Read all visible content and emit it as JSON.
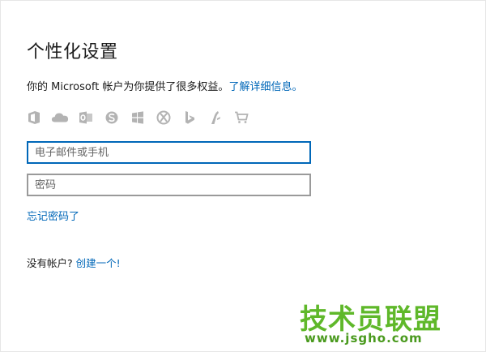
{
  "page": {
    "title": "个性化设置",
    "intro_text": "你的 Microsoft 帐户为你提供了很多权益。",
    "learn_more_link": "了解详细信息。"
  },
  "services": {
    "icons": [
      "office-icon",
      "onedrive-icon",
      "outlook-icon",
      "skype-icon",
      "windows-icon",
      "xbox-icon",
      "bing-icon",
      "msn-icon",
      "store-icon"
    ],
    "icon_color": "#b3b3b3"
  },
  "form": {
    "email_placeholder": "电子邮件或手机",
    "password_placeholder": "密码",
    "forgot_password": "忘记密码了"
  },
  "signup": {
    "prompt": "没有帐户? ",
    "create_link": "创建一个!"
  },
  "watermark": {
    "brand": "技术员联盟",
    "url": "www.jsgho.com"
  },
  "colors": {
    "accent": "#0067b8",
    "watermark_green": "#5fb82a"
  }
}
